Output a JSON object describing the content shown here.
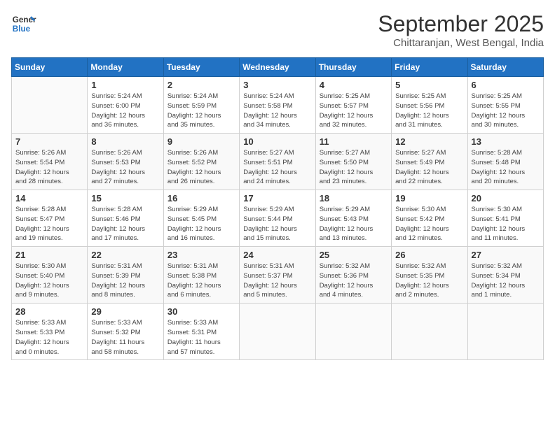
{
  "header": {
    "logo_line1": "General",
    "logo_line2": "Blue",
    "month": "September 2025",
    "location": "Chittaranjan, West Bengal, India"
  },
  "days_of_week": [
    "Sunday",
    "Monday",
    "Tuesday",
    "Wednesday",
    "Thursday",
    "Friday",
    "Saturday"
  ],
  "weeks": [
    [
      {
        "num": "",
        "info": ""
      },
      {
        "num": "1",
        "info": "Sunrise: 5:24 AM\nSunset: 6:00 PM\nDaylight: 12 hours\nand 36 minutes."
      },
      {
        "num": "2",
        "info": "Sunrise: 5:24 AM\nSunset: 5:59 PM\nDaylight: 12 hours\nand 35 minutes."
      },
      {
        "num": "3",
        "info": "Sunrise: 5:24 AM\nSunset: 5:58 PM\nDaylight: 12 hours\nand 34 minutes."
      },
      {
        "num": "4",
        "info": "Sunrise: 5:25 AM\nSunset: 5:57 PM\nDaylight: 12 hours\nand 32 minutes."
      },
      {
        "num": "5",
        "info": "Sunrise: 5:25 AM\nSunset: 5:56 PM\nDaylight: 12 hours\nand 31 minutes."
      },
      {
        "num": "6",
        "info": "Sunrise: 5:25 AM\nSunset: 5:55 PM\nDaylight: 12 hours\nand 30 minutes."
      }
    ],
    [
      {
        "num": "7",
        "info": "Sunrise: 5:26 AM\nSunset: 5:54 PM\nDaylight: 12 hours\nand 28 minutes."
      },
      {
        "num": "8",
        "info": "Sunrise: 5:26 AM\nSunset: 5:53 PM\nDaylight: 12 hours\nand 27 minutes."
      },
      {
        "num": "9",
        "info": "Sunrise: 5:26 AM\nSunset: 5:52 PM\nDaylight: 12 hours\nand 26 minutes."
      },
      {
        "num": "10",
        "info": "Sunrise: 5:27 AM\nSunset: 5:51 PM\nDaylight: 12 hours\nand 24 minutes."
      },
      {
        "num": "11",
        "info": "Sunrise: 5:27 AM\nSunset: 5:50 PM\nDaylight: 12 hours\nand 23 minutes."
      },
      {
        "num": "12",
        "info": "Sunrise: 5:27 AM\nSunset: 5:49 PM\nDaylight: 12 hours\nand 22 minutes."
      },
      {
        "num": "13",
        "info": "Sunrise: 5:28 AM\nSunset: 5:48 PM\nDaylight: 12 hours\nand 20 minutes."
      }
    ],
    [
      {
        "num": "14",
        "info": "Sunrise: 5:28 AM\nSunset: 5:47 PM\nDaylight: 12 hours\nand 19 minutes."
      },
      {
        "num": "15",
        "info": "Sunrise: 5:28 AM\nSunset: 5:46 PM\nDaylight: 12 hours\nand 17 minutes."
      },
      {
        "num": "16",
        "info": "Sunrise: 5:29 AM\nSunset: 5:45 PM\nDaylight: 12 hours\nand 16 minutes."
      },
      {
        "num": "17",
        "info": "Sunrise: 5:29 AM\nSunset: 5:44 PM\nDaylight: 12 hours\nand 15 minutes."
      },
      {
        "num": "18",
        "info": "Sunrise: 5:29 AM\nSunset: 5:43 PM\nDaylight: 12 hours\nand 13 minutes."
      },
      {
        "num": "19",
        "info": "Sunrise: 5:30 AM\nSunset: 5:42 PM\nDaylight: 12 hours\nand 12 minutes."
      },
      {
        "num": "20",
        "info": "Sunrise: 5:30 AM\nSunset: 5:41 PM\nDaylight: 12 hours\nand 11 minutes."
      }
    ],
    [
      {
        "num": "21",
        "info": "Sunrise: 5:30 AM\nSunset: 5:40 PM\nDaylight: 12 hours\nand 9 minutes."
      },
      {
        "num": "22",
        "info": "Sunrise: 5:31 AM\nSunset: 5:39 PM\nDaylight: 12 hours\nand 8 minutes."
      },
      {
        "num": "23",
        "info": "Sunrise: 5:31 AM\nSunset: 5:38 PM\nDaylight: 12 hours\nand 6 minutes."
      },
      {
        "num": "24",
        "info": "Sunrise: 5:31 AM\nSunset: 5:37 PM\nDaylight: 12 hours\nand 5 minutes."
      },
      {
        "num": "25",
        "info": "Sunrise: 5:32 AM\nSunset: 5:36 PM\nDaylight: 12 hours\nand 4 minutes."
      },
      {
        "num": "26",
        "info": "Sunrise: 5:32 AM\nSunset: 5:35 PM\nDaylight: 12 hours\nand 2 minutes."
      },
      {
        "num": "27",
        "info": "Sunrise: 5:32 AM\nSunset: 5:34 PM\nDaylight: 12 hours\nand 1 minute."
      }
    ],
    [
      {
        "num": "28",
        "info": "Sunrise: 5:33 AM\nSunset: 5:33 PM\nDaylight: 12 hours\nand 0 minutes."
      },
      {
        "num": "29",
        "info": "Sunrise: 5:33 AM\nSunset: 5:32 PM\nDaylight: 11 hours\nand 58 minutes."
      },
      {
        "num": "30",
        "info": "Sunrise: 5:33 AM\nSunset: 5:31 PM\nDaylight: 11 hours\nand 57 minutes."
      },
      {
        "num": "",
        "info": ""
      },
      {
        "num": "",
        "info": ""
      },
      {
        "num": "",
        "info": ""
      },
      {
        "num": "",
        "info": ""
      }
    ]
  ]
}
